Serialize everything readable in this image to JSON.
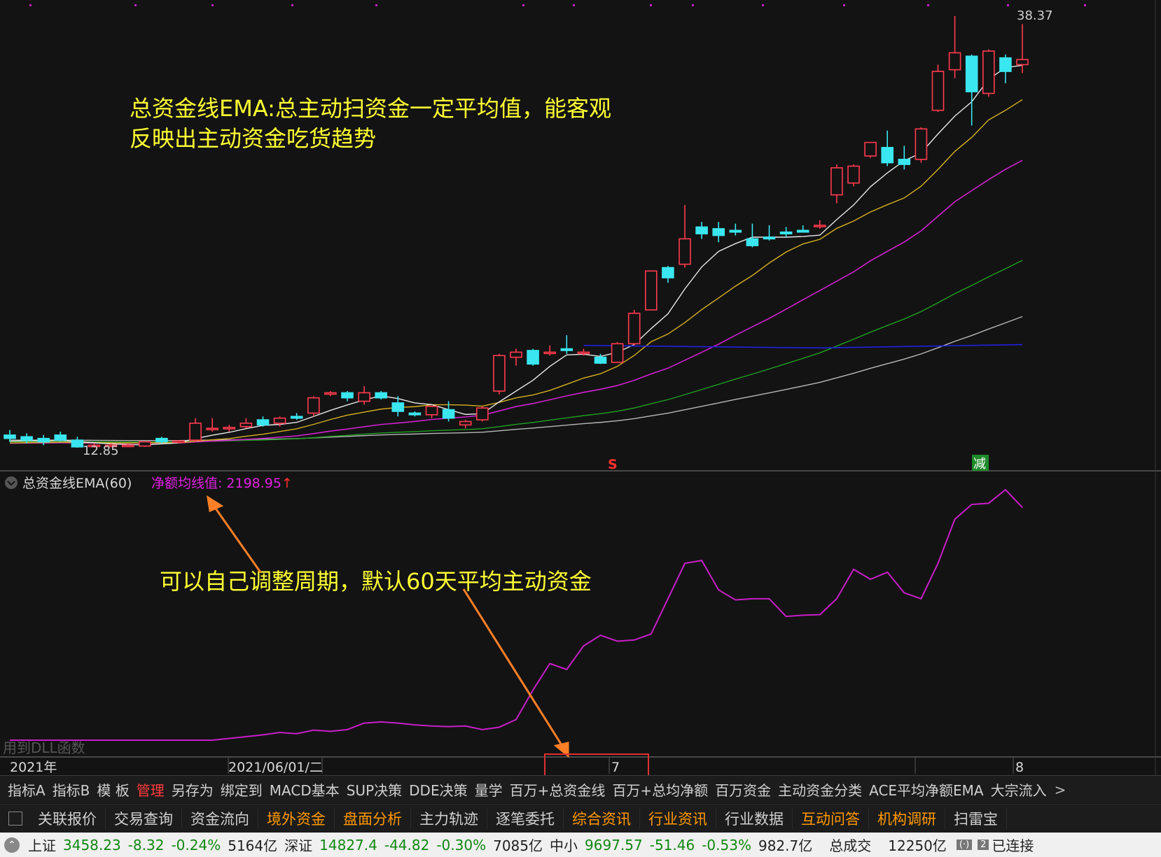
{
  "colors": {
    "up": "#ff3b4e",
    "down": "#3ae6f0",
    "ma5": "#e8e8e8",
    "ma10": "#d6b020",
    "ma20": "#d020d0",
    "ma60": "#20a020",
    "ma120": "#b8b8b8",
    "blueline": "#2020e0",
    "ema": "#c81ec8",
    "annotation": "#ffff33",
    "arrow": "#ff7f27"
  },
  "price_chart": {
    "high_label": "38.37",
    "low_label": "12.85",
    "signal_s": "S",
    "signal_jian": "减",
    "annotation_lines": [
      "总资金线EMA:总主动扫资金一定平均值，能客观",
      "反映出主动资金吃货趋势"
    ]
  },
  "indicator": {
    "name": "总资金线EMA(60)",
    "value_label": "净额均线值:",
    "value": "2198.95",
    "value_arrow": "↑",
    "annotation": "可以自己调整周期，默认60天平均主动资金",
    "watermark": "用到DLL函数"
  },
  "date_axis": [
    "2021年",
    "2021/06/01/二",
    "7",
    "8"
  ],
  "tabs": [
    "指标A",
    "指标B",
    "模 板",
    "管理",
    "另存为",
    "绑定到",
    "MACD基本",
    "SUP决策",
    "DDE决策",
    "量学",
    "百万+总资金线",
    "百万+总均净额",
    "百万资金",
    "主动资金分类",
    "ACE平均净额EMA",
    "大宗流入"
  ],
  "tabs_more": ">",
  "function_bar": [
    "关联报价",
    "交易查询",
    "资金流向",
    "境外资金",
    "盘面分析",
    "主力轨迹",
    "逐笔委托",
    "综合资讯",
    "行业资讯",
    "行业数据",
    "互动问答",
    "机构调研",
    "扫雷宝"
  ],
  "status_bar": {
    "sh": {
      "name": "上证",
      "price": "3458.23",
      "change": "-8.32",
      "pct": "-0.24%",
      "amount": "5164亿"
    },
    "sz": {
      "name": "深证",
      "price": "14827.4",
      "change": "-44.82",
      "pct": "-0.30%",
      "amount": "7085亿"
    },
    "zx": {
      "name": "中小",
      "price": "9697.57",
      "change": "-51.46",
      "pct": "-0.53%",
      "amount": "982.7亿"
    },
    "total_label": "总成交",
    "total_value": "12250亿",
    "conn_count": "2",
    "connection": "已连接"
  },
  "chart_data": {
    "type": "candlestick",
    "candles": [
      {
        "o": 13.6,
        "h": 13.9,
        "l": 13.2,
        "c": 13.4
      },
      {
        "o": 13.5,
        "h": 13.7,
        "l": 13.1,
        "c": 13.3
      },
      {
        "o": 13.4,
        "h": 13.6,
        "l": 13.0,
        "c": 13.2
      },
      {
        "o": 13.6,
        "h": 13.8,
        "l": 13.2,
        "c": 13.3
      },
      {
        "o": 13.3,
        "h": 13.5,
        "l": 12.85,
        "c": 12.9
      },
      {
        "o": 13.0,
        "h": 13.1,
        "l": 12.85,
        "c": 13.0
      },
      {
        "o": 13.0,
        "h": 13.1,
        "l": 12.9,
        "c": 13.0
      },
      {
        "o": 12.95,
        "h": 13.1,
        "l": 12.9,
        "c": 13.0
      },
      {
        "o": 12.95,
        "h": 13.2,
        "l": 12.9,
        "c": 13.2
      },
      {
        "o": 13.4,
        "h": 13.5,
        "l": 13.1,
        "c": 13.2
      },
      {
        "o": 13.2,
        "h": 13.3,
        "l": 13.1,
        "c": 13.25
      },
      {
        "o": 13.3,
        "h": 14.6,
        "l": 13.2,
        "c": 14.3
      },
      {
        "o": 14.0,
        "h": 14.6,
        "l": 13.8,
        "c": 14.0
      },
      {
        "o": 14.0,
        "h": 14.2,
        "l": 13.8,
        "c": 14.05
      },
      {
        "o": 14.1,
        "h": 14.6,
        "l": 14.0,
        "c": 14.3
      },
      {
        "o": 14.5,
        "h": 14.7,
        "l": 14.1,
        "c": 14.2
      },
      {
        "o": 14.3,
        "h": 14.7,
        "l": 14.1,
        "c": 14.6
      },
      {
        "o": 14.7,
        "h": 14.9,
        "l": 14.5,
        "c": 14.6
      },
      {
        "o": 14.9,
        "h": 15.9,
        "l": 14.7,
        "c": 15.8
      },
      {
        "o": 16.1,
        "h": 16.2,
        "l": 15.9,
        "c": 16.1
      },
      {
        "o": 16.1,
        "h": 16.2,
        "l": 15.6,
        "c": 15.8
      },
      {
        "o": 15.6,
        "h": 16.5,
        "l": 15.4,
        "c": 16.1
      },
      {
        "o": 16.1,
        "h": 16.2,
        "l": 15.7,
        "c": 15.8
      },
      {
        "o": 15.5,
        "h": 15.9,
        "l": 14.7,
        "c": 15.0
      },
      {
        "o": 14.9,
        "h": 15.0,
        "l": 14.7,
        "c": 14.8
      },
      {
        "o": 14.8,
        "h": 15.3,
        "l": 14.6,
        "c": 15.3
      },
      {
        "o": 15.1,
        "h": 15.6,
        "l": 14.4,
        "c": 14.6
      },
      {
        "o": 14.2,
        "h": 14.5,
        "l": 14.0,
        "c": 14.4
      },
      {
        "o": 14.5,
        "h": 15.3,
        "l": 14.4,
        "c": 15.2
      },
      {
        "o": 16.2,
        "h": 18.4,
        "l": 16.0,
        "c": 18.3
      },
      {
        "o": 18.2,
        "h": 18.7,
        "l": 17.7,
        "c": 18.5
      },
      {
        "o": 18.6,
        "h": 18.7,
        "l": 17.7,
        "c": 17.8
      },
      {
        "o": 18.5,
        "h": 18.9,
        "l": 18.3,
        "c": 18.5
      },
      {
        "o": 18.7,
        "h": 19.5,
        "l": 18.4,
        "c": 18.6
      },
      {
        "o": 18.5,
        "h": 18.7,
        "l": 18.3,
        "c": 18.5
      },
      {
        "o": 18.2,
        "h": 18.4,
        "l": 17.8,
        "c": 17.85
      },
      {
        "o": 17.9,
        "h": 19.1,
        "l": 17.9,
        "c": 19.0
      },
      {
        "o": 19.0,
        "h": 21.0,
        "l": 18.9,
        "c": 20.8
      },
      {
        "o": 21.0,
        "h": 23.3,
        "l": 21.0,
        "c": 23.3
      },
      {
        "o": 23.5,
        "h": 23.6,
        "l": 22.6,
        "c": 22.9
      },
      {
        "o": 23.7,
        "h": 27.2,
        "l": 23.5,
        "c": 25.2
      },
      {
        "o": 25.9,
        "h": 26.2,
        "l": 25.2,
        "c": 25.5
      },
      {
        "o": 25.8,
        "h": 26.2,
        "l": 25.0,
        "c": 25.4
      },
      {
        "o": 25.7,
        "h": 26.1,
        "l": 25.4,
        "c": 25.6
      },
      {
        "o": 25.2,
        "h": 26.1,
        "l": 24.7,
        "c": 24.8
      },
      {
        "o": 25.3,
        "h": 26.0,
        "l": 25.1,
        "c": 25.2
      },
      {
        "o": 25.6,
        "h": 25.9,
        "l": 25.3,
        "c": 25.5
      },
      {
        "o": 25.7,
        "h": 26.0,
        "l": 25.6,
        "c": 25.6
      },
      {
        "o": 26.0,
        "h": 26.3,
        "l": 25.8,
        "c": 26.0
      },
      {
        "o": 27.8,
        "h": 29.6,
        "l": 27.3,
        "c": 29.4
      },
      {
        "o": 28.5,
        "h": 29.6,
        "l": 28.3,
        "c": 29.5
      },
      {
        "o": 30.1,
        "h": 30.9,
        "l": 30.0,
        "c": 30.9
      },
      {
        "o": 30.6,
        "h": 31.6,
        "l": 29.5,
        "c": 29.7
      },
      {
        "o": 29.9,
        "h": 30.7,
        "l": 29.3,
        "c": 29.6
      },
      {
        "o": 29.9,
        "h": 31.8,
        "l": 29.7,
        "c": 31.7
      },
      {
        "o": 32.8,
        "h": 35.5,
        "l": 32.7,
        "c": 35.1
      },
      {
        "o": 35.2,
        "h": 38.37,
        "l": 34.7,
        "c": 36.2
      },
      {
        "o": 36.0,
        "h": 36.1,
        "l": 31.9,
        "c": 33.9
      },
      {
        "o": 33.8,
        "h": 36.4,
        "l": 33.6,
        "c": 36.3
      },
      {
        "o": 35.9,
        "h": 36.1,
        "l": 34.4,
        "c": 35.1
      },
      {
        "o": 35.5,
        "h": 37.9,
        "l": 35.0,
        "c": 35.8
      }
    ],
    "ema60": [
      0,
      0,
      0,
      0,
      0,
      0,
      0,
      0,
      0,
      0,
      0,
      0,
      0,
      3,
      6,
      9,
      13,
      11,
      17,
      15,
      18,
      29,
      31,
      29,
      26,
      24,
      23,
      24,
      18,
      22,
      35,
      85,
      130,
      120,
      160,
      178,
      168,
      170,
      180,
      240,
      300,
      305,
      255,
      238,
      240,
      240,
      210,
      212,
      213,
      240,
      290,
      273,
      285,
      250,
      240,
      300,
      375,
      400,
      402,
      425,
      395
    ]
  }
}
